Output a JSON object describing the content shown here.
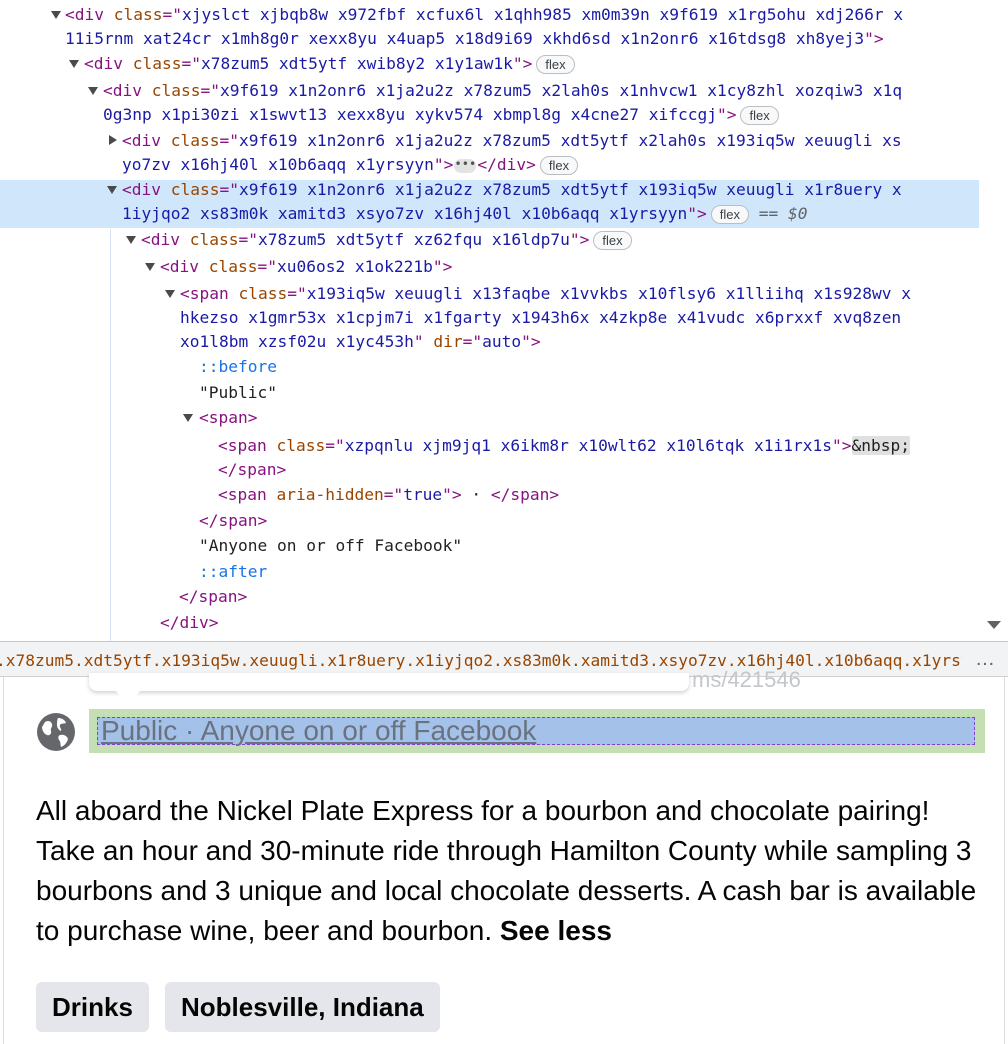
{
  "devtools": {
    "lines": [
      {
        "parts": [
          [
            "tag",
            "<div "
          ],
          [
            "an",
            "class"
          ],
          [
            "pu",
            "=\""
          ],
          [
            "av",
            "xjyslct xjbqb8w x972fbf xcfux6l x1qhh985 xm0m39n x9f619 x1rg5ohu xdj266r x"
          ]
        ]
      },
      {
        "parts": [
          [
            "av",
            "11i5rnm xat24cr x1mh8g0r xexx8yu x4uap5 x18d9i69 xkhd6sd x1n2onr6 x16tdsg8 xh8yej3"
          ],
          [
            "pu",
            "\">"
          ]
        ]
      },
      {
        "parts": [
          [
            "tag",
            "<div "
          ],
          [
            "an",
            "class"
          ],
          [
            "pu",
            "=\""
          ],
          [
            "av",
            "x78zum5 xdt5ytf xwib8y2 x1y1aw1k"
          ],
          [
            "pu",
            "\">"
          ]
        ],
        "badge": "flex"
      },
      {
        "parts": [
          [
            "tag",
            "<div "
          ],
          [
            "an",
            "class"
          ],
          [
            "pu",
            "=\""
          ],
          [
            "av",
            "x9f619 x1n2onr6 x1ja2u2z x78zum5 x2lah0s x1nhvcw1 x1cy8zhl xozqiw3 x1q"
          ]
        ]
      },
      {
        "parts": [
          [
            "av",
            "0g3np x1pi30zi x1swvt13 xexx8yu xykv574 xbmpl8g x4cne27 xifccgj"
          ],
          [
            "pu",
            "\">"
          ]
        ],
        "badge": "flex"
      },
      {
        "parts": [
          [
            "tag",
            "<div "
          ],
          [
            "an",
            "class"
          ],
          [
            "pu",
            "=\""
          ],
          [
            "av",
            "x9f619 x1n2onr6 x1ja2u2z x78zum5 xdt5ytf x2lah0s x193iq5w xeuugli xs"
          ]
        ]
      },
      {
        "parts": [
          [
            "av",
            "yo7zv x16hj40l x10b6aqq x1yrsyyn"
          ],
          [
            "pu",
            "\">"
          ]
        ],
        "ellipsis": "•••",
        "after": [
          [
            "tag",
            "</div>"
          ]
        ],
        "badge": "flex"
      },
      {
        "parts": [
          [
            "tag",
            "<div "
          ],
          [
            "an",
            "class"
          ],
          [
            "pu",
            "=\""
          ],
          [
            "av",
            "x9f619 x1n2onr6 x1ja2u2z x78zum5 xdt5ytf x193iq5w xeuugli x1r8uery x"
          ]
        ]
      },
      {
        "parts": [
          [
            "av",
            "1iyjqo2 xs83m0k xamitd3 xsyo7zv x16hj40l x10b6aqq x1yrsyyn"
          ],
          [
            "pu",
            "\">"
          ]
        ],
        "badge": "flex",
        "marker": "== $0"
      },
      {
        "parts": [
          [
            "tag",
            "<div "
          ],
          [
            "an",
            "class"
          ],
          [
            "pu",
            "=\""
          ],
          [
            "av",
            "x78zum5 xdt5ytf xz62fqu x16ldp7u"
          ],
          [
            "pu",
            "\">"
          ]
        ],
        "badge": "flex"
      },
      {
        "parts": [
          [
            "tag",
            "<div "
          ],
          [
            "an",
            "class"
          ],
          [
            "pu",
            "=\""
          ],
          [
            "av",
            "xu06os2 x1ok221b"
          ],
          [
            "pu",
            "\">"
          ]
        ]
      },
      {
        "parts": [
          [
            "tag",
            "<span "
          ],
          [
            "an",
            "class"
          ],
          [
            "pu",
            "=\""
          ],
          [
            "av",
            "x193iq5w xeuugli x13faqbe x1vvkbs x10flsy6 x1lliihq x1s928wv x"
          ]
        ]
      },
      {
        "parts": [
          [
            "av",
            "hkezso x1gmr53x x1cpjm7i x1fgarty x1943h6x x4zkp8e x41vudc x6prxxf xvq8zen"
          ]
        ]
      },
      {
        "parts": [
          [
            "av",
            "xo1l8bm xzsf02u x1yc453h"
          ],
          [
            "pu",
            "\" "
          ],
          [
            "an",
            "dir"
          ],
          [
            "pu",
            "=\""
          ],
          [
            "av",
            "auto"
          ],
          [
            "pu",
            "\">"
          ]
        ]
      },
      {
        "parts": [
          [
            "ps",
            "::before"
          ]
        ]
      },
      {
        "parts": [
          [
            "tx",
            "\"Public\""
          ]
        ]
      },
      {
        "parts": [
          [
            "tag",
            "<span>"
          ]
        ]
      },
      {
        "parts": [
          [
            "tag",
            "<span "
          ],
          [
            "an",
            "class"
          ],
          [
            "pu",
            "=\""
          ],
          [
            "av",
            "xzpqnlu xjm9jq1 x6ikm8r x10wlt62 x10l6tqk x1i1rx1s"
          ],
          [
            "pu",
            "\">"
          ],
          [
            "ent",
            "&nbsp;"
          ]
        ]
      },
      {
        "parts": [
          [
            "tag",
            "</span>"
          ]
        ]
      },
      {
        "parts": [
          [
            "tag",
            "<span "
          ],
          [
            "an",
            "aria-hidden"
          ],
          [
            "pu",
            "=\""
          ],
          [
            "av",
            "true"
          ],
          [
            "pu",
            "\">"
          ],
          [
            "tx",
            " · "
          ],
          [
            "tag",
            "</span>"
          ]
        ]
      },
      {
        "parts": [
          [
            "tag",
            "</span>"
          ]
        ]
      },
      {
        "parts": [
          [
            "tx",
            "\"Anyone on or off Facebook\""
          ]
        ]
      },
      {
        "parts": [
          [
            "ps",
            "::after"
          ]
        ]
      },
      {
        "parts": [
          [
            "tag",
            "</span>"
          ]
        ]
      },
      {
        "parts": [
          [
            "tag",
            "</div>"
          ]
        ]
      }
    ]
  },
  "breadcrumb": {
    "path": ".x78zum5.xdt5ytf.x193iq5w.xeuugli.x1r8uery.x1iyjqo2.xs83m0k.xamitd3.xsyo7zv.x16hj40l.x10b6aqq.x1yrsyyn",
    "more": "…"
  },
  "post": {
    "privacy_text": "Public · Anyone on or off Facebook",
    "privacy_icon": "globe-icon",
    "description": "All aboard the Nickel Plate Express for a bourbon and chocolate pairing! Take an hour and 30-minute ride through Hamilton County while sampling 3 bourbons and 3 unique and local chocolate desserts. A cash bar is available to purchase wine, beer and bourbon.",
    "see_less": "See less",
    "tags": [
      "Drinks",
      "Noblesville, Indiana"
    ]
  },
  "colors": {
    "selected_row": "#cfe6fb",
    "tag_name": "#881280",
    "attr_name": "#994500",
    "attr_value": "#1a1aa6",
    "highlight_margin": "#c4dfb3",
    "highlight_content": "#a4c2e9"
  }
}
